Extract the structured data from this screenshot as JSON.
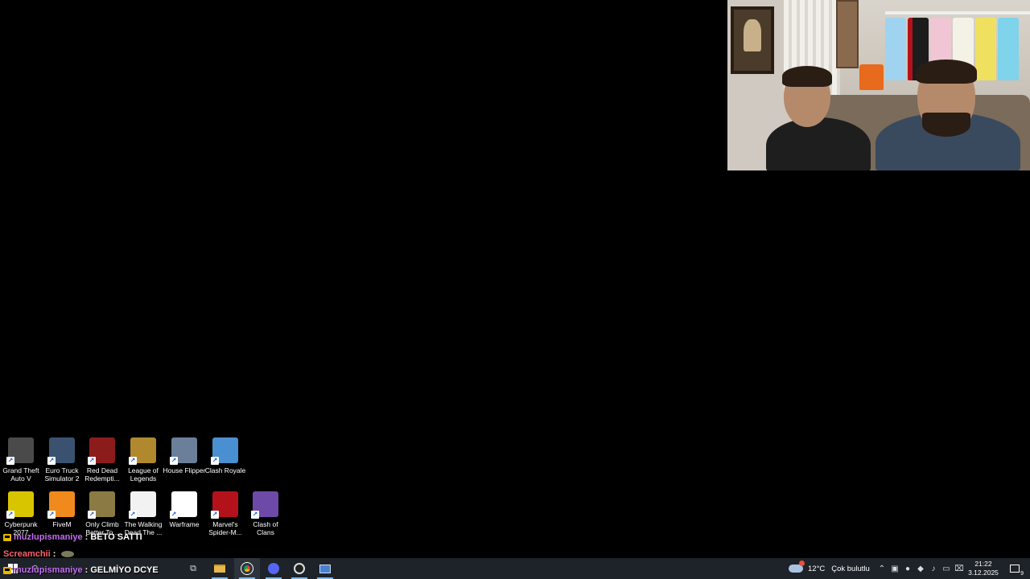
{
  "desktop": {
    "icons": [
      {
        "label": "Grand Theft Auto V",
        "icon": "gta5-icon",
        "color": "#4a4a4a"
      },
      {
        "label": "Euro Truck Simulator 2",
        "icon": "ets2-icon",
        "color": "#3a5270"
      },
      {
        "label": "Red Dead Redempti...",
        "icon": "rdr2-icon",
        "color": "#8c1c1c"
      },
      {
        "label": "League of Legends",
        "icon": "lol-icon",
        "color": "#b0892e"
      },
      {
        "label": "House Flipper",
        "icon": "house-flipper-icon",
        "color": "#6b7f99"
      },
      {
        "label": "Clash Royale",
        "icon": "clash-royale-icon",
        "color": "#4a8fd0"
      },
      {
        "label": "Cyberpunk 2077",
        "icon": "cyberpunk-icon",
        "color": "#d9c400"
      },
      {
        "label": "FiveM",
        "icon": "fivem-icon",
        "color": "#f08a1c"
      },
      {
        "label": "Only Climb Better To...",
        "icon": "only-climb-icon",
        "color": "#8a7a44"
      },
      {
        "label": "The Walking Dead The ...",
        "icon": "walking-dead-icon",
        "color": "#f2f2f2"
      },
      {
        "label": "Warframe",
        "icon": "warframe-icon",
        "color": "#ffffff"
      },
      {
        "label": "Marvel's Spider-M...",
        "icon": "spiderman-icon",
        "color": "#b3121b"
      },
      {
        "label": "Clash of Clans",
        "icon": "clash-of-clans-icon",
        "color": "#6e4aa8"
      }
    ]
  },
  "chat": [
    {
      "user": "muzlupismaniye",
      "separator": " : ",
      "message": "BETO SATTI"
    },
    {
      "user": "Screamchii",
      "separator": " : ",
      "message": ""
    },
    {
      "user": "muzlupismaniye",
      "separator": " : ",
      "message": "GELMİYO DCYE"
    }
  ],
  "taskbar": {
    "weather_temp": "12°C",
    "weather_text": "Çok bulutlu",
    "time": "21:22",
    "date": "3.12.2025",
    "notification_count": "9",
    "accent": "#76b9ed"
  }
}
